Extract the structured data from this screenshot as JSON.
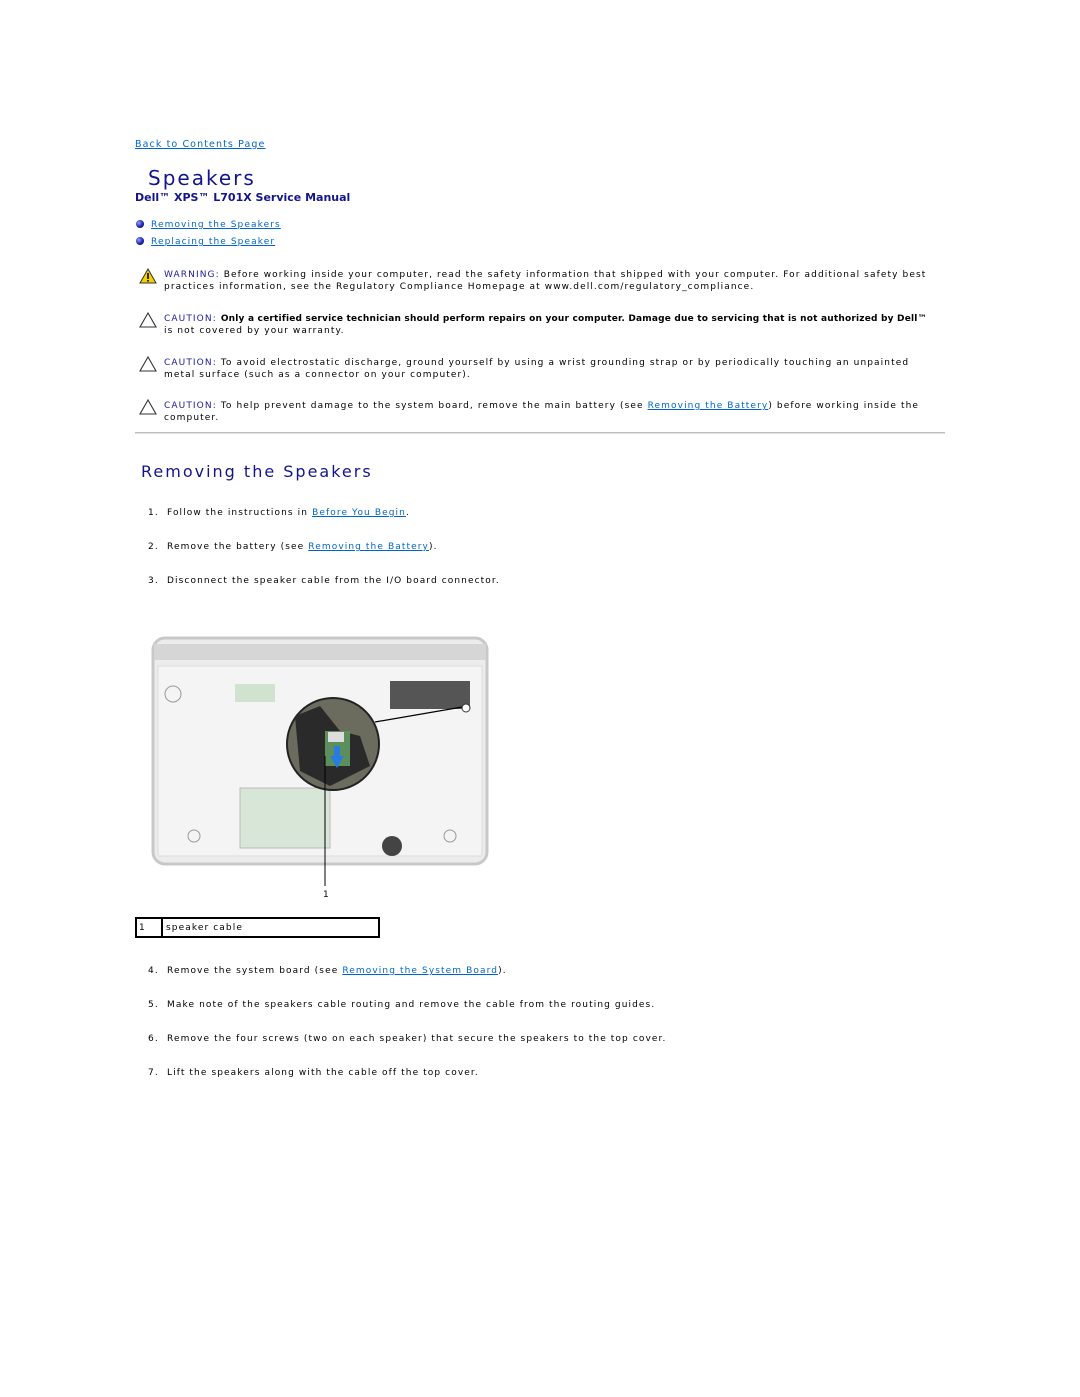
{
  "back_link": "Back to Contents Page",
  "title": "Speakers",
  "subtitle": "Dell™ XPS™ L701X Service Manual",
  "toc": [
    "Removing the Speakers",
    "Replacing the Speaker"
  ],
  "notices": [
    {
      "type": "warning",
      "label": "WARNING:",
      "text": "Before working inside your computer, read the safety information that shipped with your computer. For additional safety best practices information, see the Regulatory Compliance Homepage at www.dell.com/regulatory_compliance."
    },
    {
      "type": "caution",
      "label": "CAUTION:",
      "bold": "Only a certified service technician should perform repairs on your computer. Damage due to servicing that is not authorized by Dell™",
      "text": "is not covered by your warranty."
    },
    {
      "type": "caution",
      "label": "CAUTION:",
      "text": "To avoid electrostatic discharge, ground yourself by using a wrist grounding strap or by periodically touching an unpainted metal surface (such as a connector on your computer)."
    },
    {
      "type": "caution",
      "label": "CAUTION:",
      "pre": "To help prevent damage to the system board, remove the main battery (see ",
      "link": "Removing the Battery",
      "post": ") before working inside the computer."
    }
  ],
  "section_title": "Removing the Speakers",
  "steps": [
    {
      "num": "1.",
      "pre": "Follow the instructions in ",
      "link": "Before You Begin",
      "post": "."
    },
    {
      "num": "2.",
      "pre": "Remove the battery (see ",
      "link": "Removing the Battery",
      "post": ")."
    },
    {
      "num": "3.",
      "pre": "Disconnect the speaker cable from the I/O board connector."
    },
    {
      "num": "4.",
      "pre": "Remove the system board (see ",
      "link": "Removing the System Board",
      "post": ")."
    },
    {
      "num": "5.",
      "pre": "Make note of the speakers cable routing and remove the cable from the routing guides."
    },
    {
      "num": "6.",
      "pre": "Remove the four screws (two on each speaker) that secure the speakers to the top cover."
    },
    {
      "num": "7.",
      "pre": "Lift the speakers along with the cable off the top cover."
    }
  ],
  "figure": {
    "callout": "1",
    "legend": [
      {
        "num": "1",
        "label": "speaker cable"
      }
    ]
  },
  "colors": {
    "link": "#0066cc",
    "heading": "#14148c",
    "warning_icon": "#f5d000"
  }
}
